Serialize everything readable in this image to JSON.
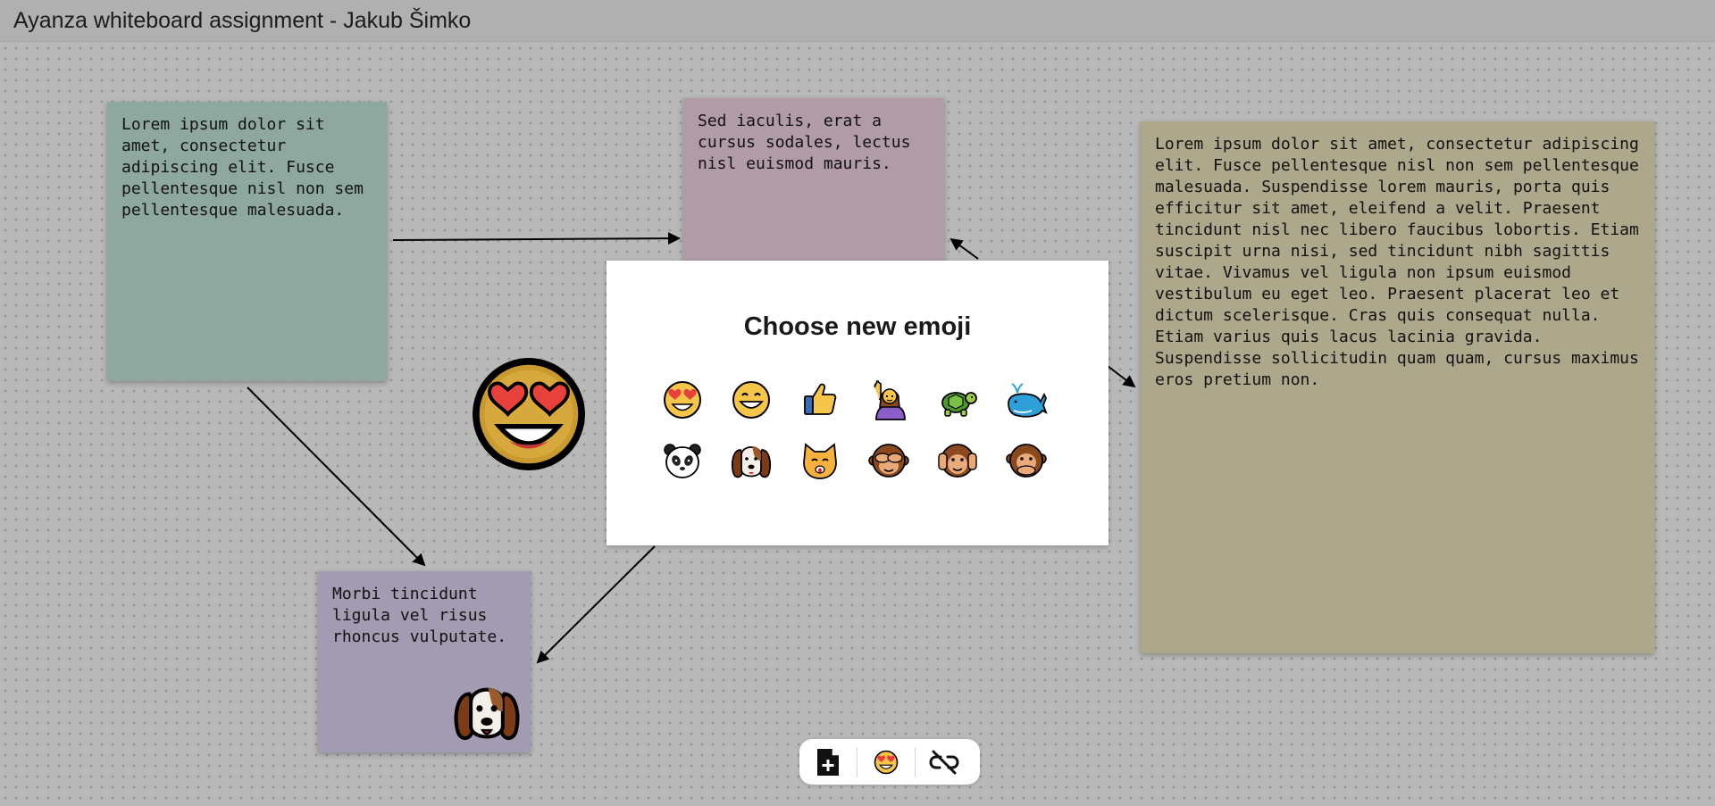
{
  "app": {
    "title": "Ayanza whiteboard assignment - Jakub Šimko"
  },
  "notes": [
    {
      "id": "note-1",
      "color": "#8fa89f",
      "text": "Lorem ipsum dolor sit amet, consectetur adipiscing elit. Fusce pellentesque nisl non sem pellentesque malesuada."
    },
    {
      "id": "note-2",
      "color": "#b19ba7",
      "text": "Sed iaculis, erat a cursus sodales, lectus nisl euismod mauris."
    },
    {
      "id": "note-3",
      "color": "#ada78b",
      "text": "Lorem ipsum dolor sit amet, consectetur adipiscing elit. Fusce pellentesque nisl non sem pellentesque malesuada. Suspendisse lorem mauris, porta quis efficitur sit amet, eleifend a velit. Praesent tincidunt nisl nec libero faucibus lobortis. Etiam suscipit urna nisi, sed tincidunt nibh sagittis vitae. Vivamus vel ligula non ipsum euismod vestibulum eu eget leo. Praesent placerat leo et dictum scelerisque. Cras quis consequat nulla. Etiam varius quis lacus lacinia gravida. Suspendisse sollicitudin quam quam, cursus maximus eros pretium non."
    },
    {
      "id": "note-4",
      "color": "#a29bb1",
      "text": "Morbi tincidunt ligula vel risus rhoncus vulputate.",
      "emoji": "dog-face"
    }
  ],
  "board_emoji": "smiling-face-with-heart-eyes",
  "modal": {
    "title": "Choose new emoji",
    "emojis": [
      "smiling-face-with-heart-eyes",
      "grinning-face",
      "thumbs-up",
      "person-raising-hand",
      "turtle",
      "spouting-whale",
      "panda",
      "dog-face",
      "cat-face",
      "see-no-evil-monkey",
      "hear-no-evil-monkey",
      "speak-no-evil-monkey"
    ]
  },
  "toolbar": {
    "buttons": [
      "add-note-icon",
      "emoji-icon",
      "unlink-icon"
    ]
  },
  "colors": {
    "board": "#b9b9b9",
    "titlebar": "#b0b0b0",
    "modal_bg": "#ffffff",
    "emoji_yellow": "#f6c64b",
    "heart_red": "#e8403a"
  }
}
